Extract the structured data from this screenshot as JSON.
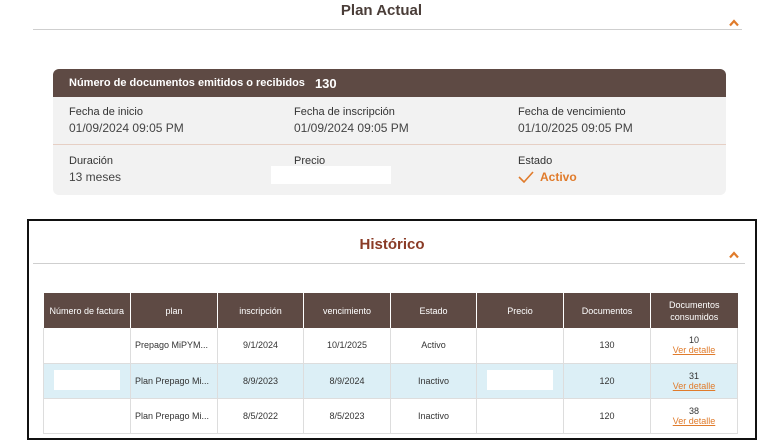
{
  "plan_actual": {
    "title": "Plan Actual",
    "docs_label": "Número de documentos emitidos o recibidos",
    "docs_value": "130",
    "fecha_inicio_label": "Fecha de inicio",
    "fecha_inicio": "01/09/2024 09:05 PM",
    "fecha_inscripcion_label": "Fecha de inscripción",
    "fecha_inscripcion": "01/09/2024 09:05 PM",
    "fecha_vencimiento_label": "Fecha de vencimiento",
    "fecha_vencimiento": "01/10/2025 09:05 PM",
    "duracion_label": "Duración",
    "duracion": "13 meses",
    "precio_label": "Precio",
    "estado_label": "Estado",
    "estado": "Activo"
  },
  "historico": {
    "title": "Histórico",
    "columns": [
      "Número de factura",
      "plan",
      "inscripción",
      "vencimiento",
      "Estado",
      "Precio",
      "Documentos",
      "Documentos consumidos"
    ],
    "rows": [
      {
        "plan": "Prepago MiPYM...",
        "inscripcion": "9/1/2024",
        "vencimiento": "10/1/2025",
        "estado": "Activo",
        "documentos": "130",
        "consumidos": "10",
        "link": "Ver detalle"
      },
      {
        "plan": "Plan Prepago Mi...",
        "inscripcion": "8/9/2023",
        "vencimiento": "8/9/2024",
        "estado": "Inactivo",
        "documentos": "120",
        "consumidos": "31",
        "link": "Ver detalle"
      },
      {
        "plan": "Plan Prepago Mi...",
        "inscripcion": "8/5/2022",
        "vencimiento": "8/5/2023",
        "estado": "Inactivo",
        "documentos": "120",
        "consumidos": "38",
        "link": "Ver detalle"
      }
    ]
  },
  "colors": {
    "header_brown": "#5e4a44",
    "accent_orange": "#e07b2b",
    "historico_title": "#8a3b26",
    "highlight_row": "#dceff6"
  },
  "icons": {
    "collapse": "chevron-up-icon",
    "status": "check-icon"
  }
}
